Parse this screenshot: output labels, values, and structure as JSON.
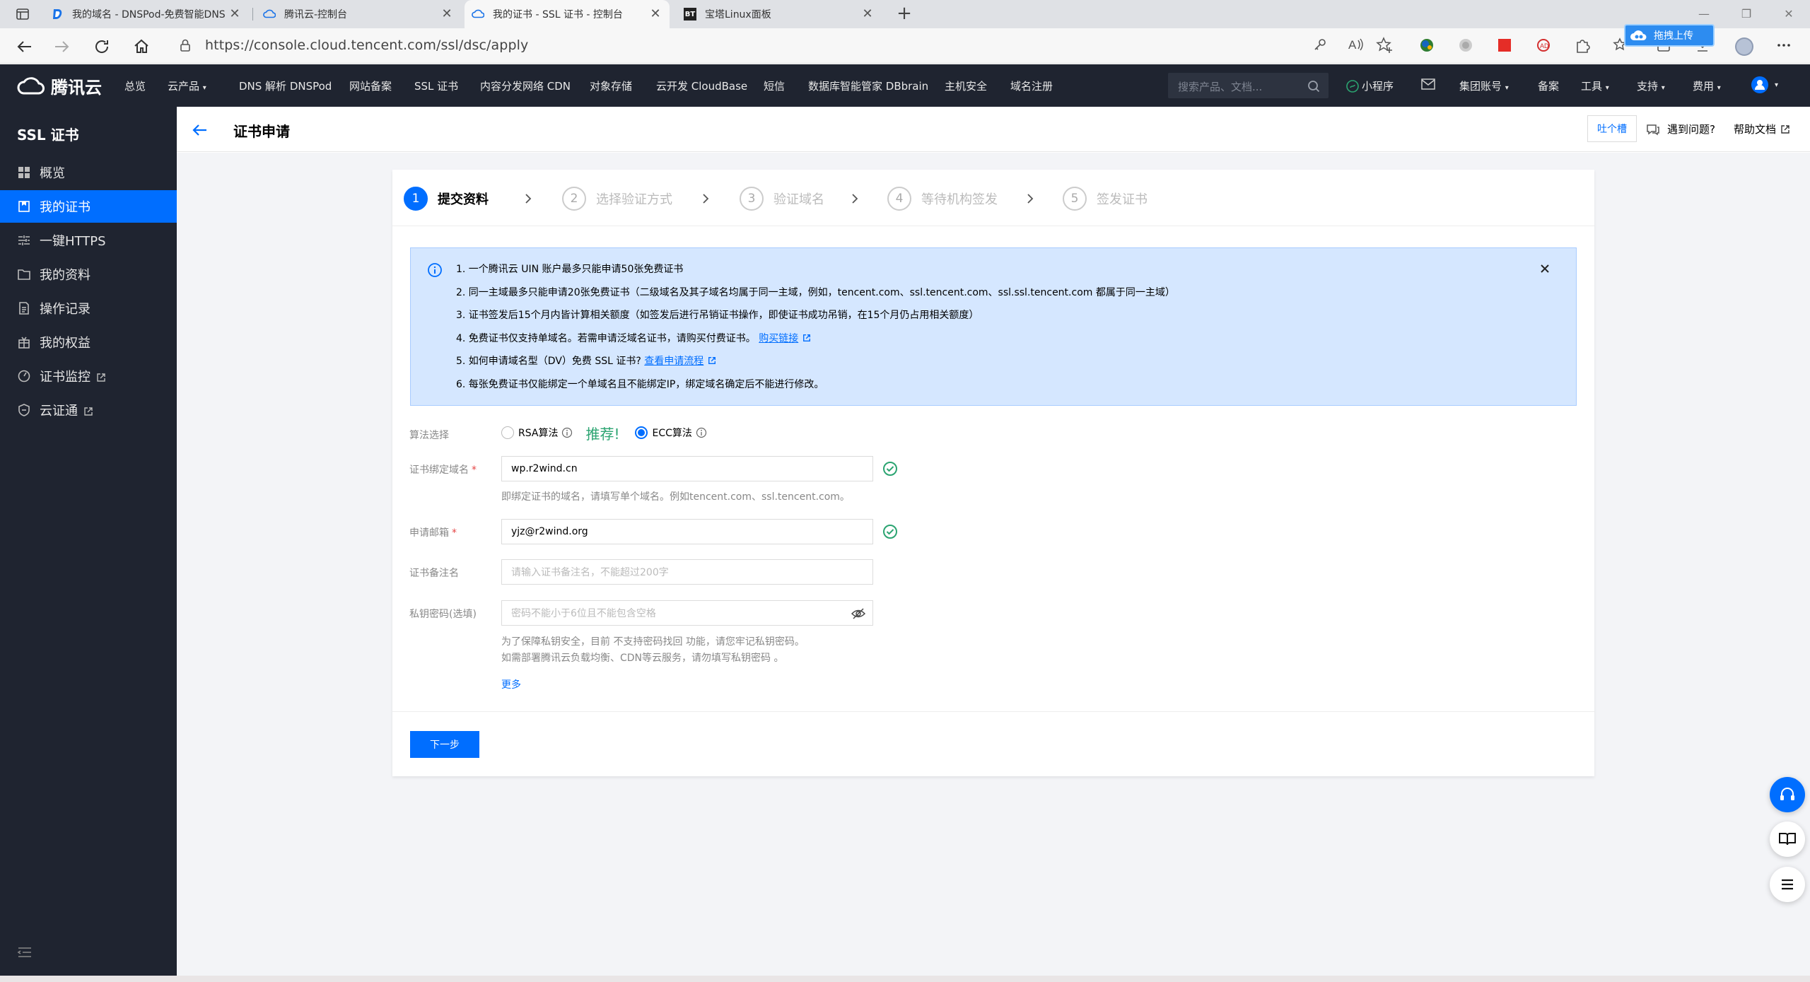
{
  "browser": {
    "tabs": [
      {
        "title": "我的域名 - DNSPod-免费智能DNS"
      },
      {
        "title": "腾讯云-控制台"
      },
      {
        "title": "我的证书 - SSL 证书 - 控制台"
      },
      {
        "title": "宝塔Linux面板"
      }
    ],
    "bt_favicon_text": "BT",
    "url": "https://console.cloud.tencent.com/ssl/dsc/apply",
    "upload_badge": "拖拽上传"
  },
  "topnav": {
    "brand": "腾讯云",
    "items": [
      "总览",
      "云产品",
      "DNS 解析 DNSPod",
      "网站备案",
      "SSL 证书",
      "内容分发网络 CDN",
      "对象存储",
      "云开发 CloudBase",
      "短信",
      "数据库智能管家 DBbrain",
      "主机安全",
      "域名注册"
    ],
    "search_placeholder": "搜索产品、文档...",
    "right_items": [
      "小程序",
      "集团账号",
      "备案",
      "工具",
      "支持",
      "费用"
    ]
  },
  "sidebar": {
    "title": "SSL 证书",
    "items": [
      {
        "label": "概览"
      },
      {
        "label": "我的证书"
      },
      {
        "label": "一键HTTPS"
      },
      {
        "label": "我的资料"
      },
      {
        "label": "操作记录"
      },
      {
        "label": "我的权益"
      },
      {
        "label": "证书监控"
      },
      {
        "label": "云证通"
      }
    ]
  },
  "page": {
    "title": "证书申请",
    "feedback": "吐个槽",
    "help_question": "遇到问题?",
    "help_docs": "帮助文档"
  },
  "steps": [
    {
      "num": "1",
      "label": "提交资料"
    },
    {
      "num": "2",
      "label": "选择验证方式"
    },
    {
      "num": "3",
      "label": "验证域名"
    },
    {
      "num": "4",
      "label": "等待机构签发"
    },
    {
      "num": "5",
      "label": "签发证书"
    }
  ],
  "notice": {
    "lines": [
      "1. 一个腾讯云 UIN 账户最多只能申请50张免费证书",
      "2. 同一主域最多只能申请20张免费证书（二级域名及其子域名均属于同一主域，例如，tencent.com、ssl.tencent.com、ssl.ssl.tencent.com 都属于同一主域）",
      "3. 证书签发后15个月内皆计算相关额度（如签发后进行吊销证书操作，即使证书成功吊销，在15个月仍占用相关额度）",
      "4. 免费证书仅支持单域名。若需申请泛域名证书，请购买付费证书。",
      "5. 如何申请域名型（DV）免费 SSL 证书?",
      "6. 每张免费证书仅能绑定一个单域名且不能绑定IP，绑定域名确定后不能进行修改。"
    ],
    "buy_link": "购买链接",
    "flow_link": "查看申请流程"
  },
  "form": {
    "algo_label": "算法选择",
    "rsa_label": "RSA算法",
    "recommend": "推荐!",
    "ecc_label": "ECC算法",
    "domain_label": "证书绑定域名",
    "domain_value": "wp.r2wind.cn",
    "domain_hint": "即绑定证书的域名，请填写单个域名。例如tencent.com、ssl.tencent.com。",
    "email_label": "申请邮箱",
    "email_value": "yjz@r2wind.org",
    "remark_label": "证书备注名",
    "remark_placeholder": "请输入证书备注名，不能超过200字",
    "pwd_label": "私钥密码(选填)",
    "pwd_placeholder": "密码不能小于6位且不能包含空格",
    "pwd_hint1": "为了保障私钥安全，目前 不支持密码找回 功能，请您牢记私钥密码。",
    "pwd_hint2": "如需部署腾讯云负载均衡、CDN等云服务，请勿填写私钥密码 。",
    "more": "更多",
    "next": "下一步"
  },
  "colors": {
    "primary": "#006eff",
    "sidebar_bg": "#1f2430",
    "notice_bg": "#d5e7ff",
    "success": "#2ba471",
    "required": "#e54545"
  }
}
